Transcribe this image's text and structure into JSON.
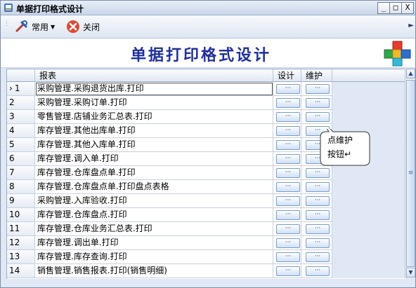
{
  "window": {
    "title": "单据打印格式设计",
    "minimize_label": "_",
    "maximize_label": "□",
    "close_label": "X"
  },
  "toolbar": {
    "common_label": "常用",
    "close_label": "关闭"
  },
  "header": {
    "title": "单据打印格式设计"
  },
  "grid": {
    "columns": [
      "",
      "报表",
      "设计",
      "维护"
    ],
    "button_label": "···",
    "rows": [
      {
        "num": "1",
        "name": "采购管理.采购退货出库.打印",
        "current": true
      },
      {
        "num": "2",
        "name": "采购管理.采购订单.打印"
      },
      {
        "num": "3",
        "name": "零售管理.店铺业务汇总表.打印"
      },
      {
        "num": "4",
        "name": "库存管理.其他出库单.打印"
      },
      {
        "num": "5",
        "name": "库存管理.其他入库单.打印"
      },
      {
        "num": "6",
        "name": "库存管理.调入单.打印"
      },
      {
        "num": "7",
        "name": "库存管理.仓库盘点单.打印"
      },
      {
        "num": "8",
        "name": "库存管理.仓库盘点单.打印盘点表格"
      },
      {
        "num": "9",
        "name": "采购管理.入库验收.打印"
      },
      {
        "num": "10",
        "name": "库存管理.仓库盘点.打印"
      },
      {
        "num": "11",
        "name": "库存管理.仓库业务汇总表.打印"
      },
      {
        "num": "12",
        "name": "库存管理.调出单.打印"
      },
      {
        "num": "13",
        "name": "库存管理.库存查询.打印"
      },
      {
        "num": "14",
        "name": "销售管理.销售报表.打印(销售明细)"
      }
    ],
    "current_marker": "›"
  },
  "callout": {
    "line1": "点维护",
    "line2": "按钮↵"
  },
  "colors": {
    "title_blue": "#1f2f9e",
    "window_bg": "#dfe8f4",
    "button_face": "#cfe0f7"
  }
}
